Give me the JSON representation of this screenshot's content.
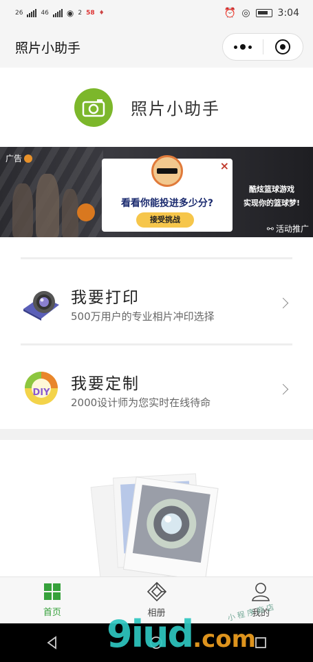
{
  "status_bar": {
    "time": "3:04",
    "network_1": "26",
    "network_2": "46",
    "hotspot_count": "2",
    "app_badge": "58"
  },
  "nav": {
    "title": "照片小助手"
  },
  "header": {
    "app_name": "照片小助手"
  },
  "ad": {
    "tag": "广告",
    "headline": "看看你能投进多少分?",
    "button": "接受挑战",
    "right_line1": "酷炫篮球游戏",
    "right_line2": "实现你的篮球梦!",
    "promo": "活动推广",
    "close": "×"
  },
  "services": [
    {
      "title": "我要打印",
      "subtitle": "500万用户的专业相片冲印选择",
      "icon": "camera-lens-icon"
    },
    {
      "title": "我要定制",
      "subtitle": "2000设计师为您实时在线待命",
      "icon": "lemon-diy-icon"
    }
  ],
  "tabs": [
    {
      "label": "首页",
      "icon": "grid-home-icon",
      "active": true
    },
    {
      "label": "相册",
      "icon": "album-icon",
      "active": false
    },
    {
      "label": "我的",
      "icon": "user-icon",
      "active": false
    }
  ],
  "watermark": {
    "main": "9iud",
    "suffix": ".com",
    "cn": "小 程 序 商 店"
  },
  "colors": {
    "accent": "#36a13b",
    "logo_green": "#7cb72b",
    "ad_button": "#f6c64b"
  }
}
